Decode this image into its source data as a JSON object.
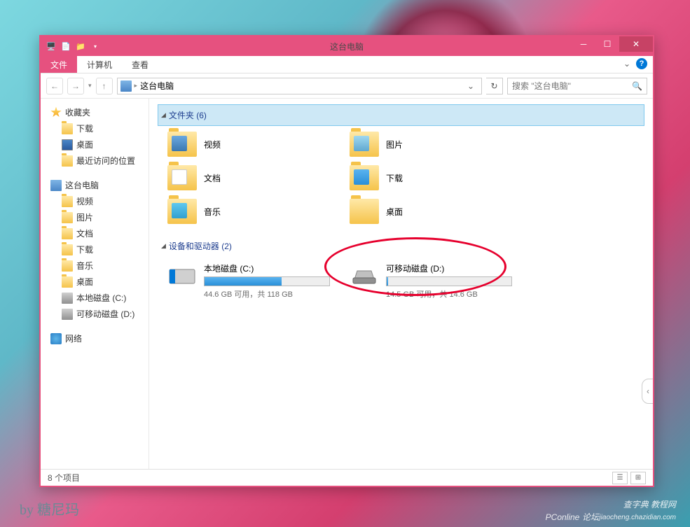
{
  "window": {
    "title": "这台电脑",
    "ribbon": {
      "file": "文件",
      "computer": "计算机",
      "view": "查看"
    },
    "address": {
      "location": "这台电脑"
    },
    "search": {
      "placeholder": "搜索 \"这台电脑\""
    }
  },
  "sidebar": {
    "favorites": {
      "label": "收藏夹"
    },
    "downloads": {
      "label": "下载"
    },
    "desktop": {
      "label": "桌面"
    },
    "recent": {
      "label": "最近访问的位置"
    },
    "thispc": {
      "label": "这台电脑"
    },
    "videos": {
      "label": "视频"
    },
    "pictures": {
      "label": "图片"
    },
    "documents": {
      "label": "文档"
    },
    "downloads2": {
      "label": "下载"
    },
    "music": {
      "label": "音乐"
    },
    "desktop2": {
      "label": "桌面"
    },
    "drivec": {
      "label": "本地磁盘 (C:)"
    },
    "drived": {
      "label": "可移动磁盘 (D:)"
    },
    "network": {
      "label": "网络"
    }
  },
  "content": {
    "folders_header": "文件夹 (6)",
    "drives_header": "设备和驱动器 (2)",
    "folders": {
      "videos": "视频",
      "pictures": "图片",
      "documents": "文档",
      "downloads": "下载",
      "music": "音乐",
      "desktop": "桌面"
    },
    "drives": {
      "c": {
        "name": "本地磁盘 (C:)",
        "status": "44.6 GB 可用，共 118 GB",
        "used_pct": 62
      },
      "d": {
        "name": "可移动磁盘 (D:)",
        "status": "14.5 GB 可用，共 14.6 GB",
        "used_pct": 1
      }
    }
  },
  "status": {
    "items": "8 个项目"
  },
  "byline": "by 糖尼玛",
  "watermark": {
    "site1": "查字典 教程网",
    "site2": "jiaocheng.chazidian.com",
    "forum": "PConline",
    "forum2": "论坛"
  }
}
